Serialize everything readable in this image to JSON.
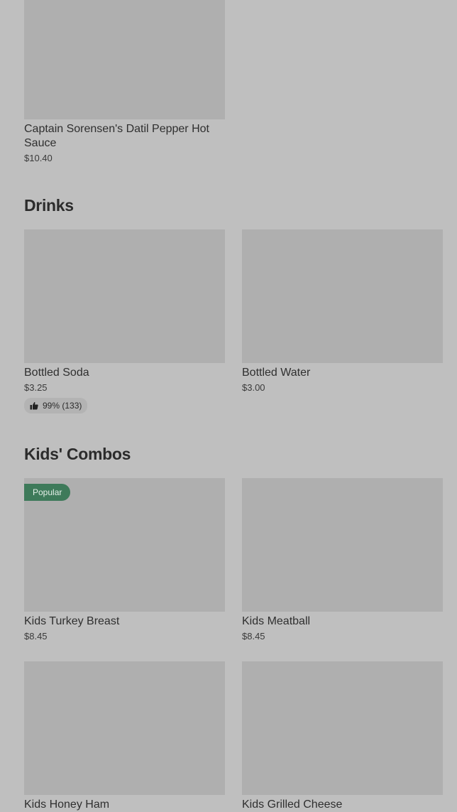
{
  "items": {
    "hot_sauce": {
      "name": "Captain Sorensen's Datil Pepper Hot Sauce",
      "price": "$10.40"
    },
    "soda": {
      "name": "Bottled Soda",
      "price": "$3.25",
      "rating": "99% (133)"
    },
    "water": {
      "name": "Bottled Water",
      "price": "$3.00"
    },
    "turkey": {
      "name": "Kids Turkey Breast",
      "price": "$8.45",
      "badge": "Popular"
    },
    "meatball": {
      "name": "Kids Meatball",
      "price": "$8.45"
    },
    "ham": {
      "name": "Kids Honey Ham"
    },
    "grilled": {
      "name": "Kids Grilled Cheese"
    }
  },
  "sections": {
    "drinks": "Drinks",
    "kids_combos": "Kids' Combos"
  },
  "colors": {
    "background": "#bfbfbf",
    "image_placeholder": "#afafaf",
    "badge": "#3e7a5a"
  },
  "icons": {
    "rating": "thumbs-up-icon"
  }
}
